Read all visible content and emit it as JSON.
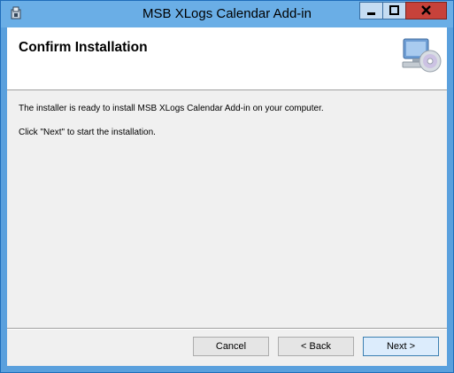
{
  "window": {
    "title": "MSB XLogs Calendar Add-in",
    "icons": {
      "app": "installer-icon",
      "minimize": "minimize-icon",
      "maximize": "maximize-icon",
      "close": "close-icon"
    }
  },
  "banner": {
    "title": "Confirm Installation",
    "graphic": "computer-with-cd-icon"
  },
  "content": {
    "ready_text": "The installer is ready to install MSB XLogs Calendar Add-in on your computer.",
    "instruction_text": "Click \"Next\" to start the installation."
  },
  "buttons": {
    "cancel": "Cancel",
    "back": "< Back",
    "next": "Next >"
  },
  "colors": {
    "titlebar": "#6aaee6",
    "close_button": "#c7423a",
    "client_background": "#f0f0f0",
    "default_button_border": "#3c7fb1"
  }
}
